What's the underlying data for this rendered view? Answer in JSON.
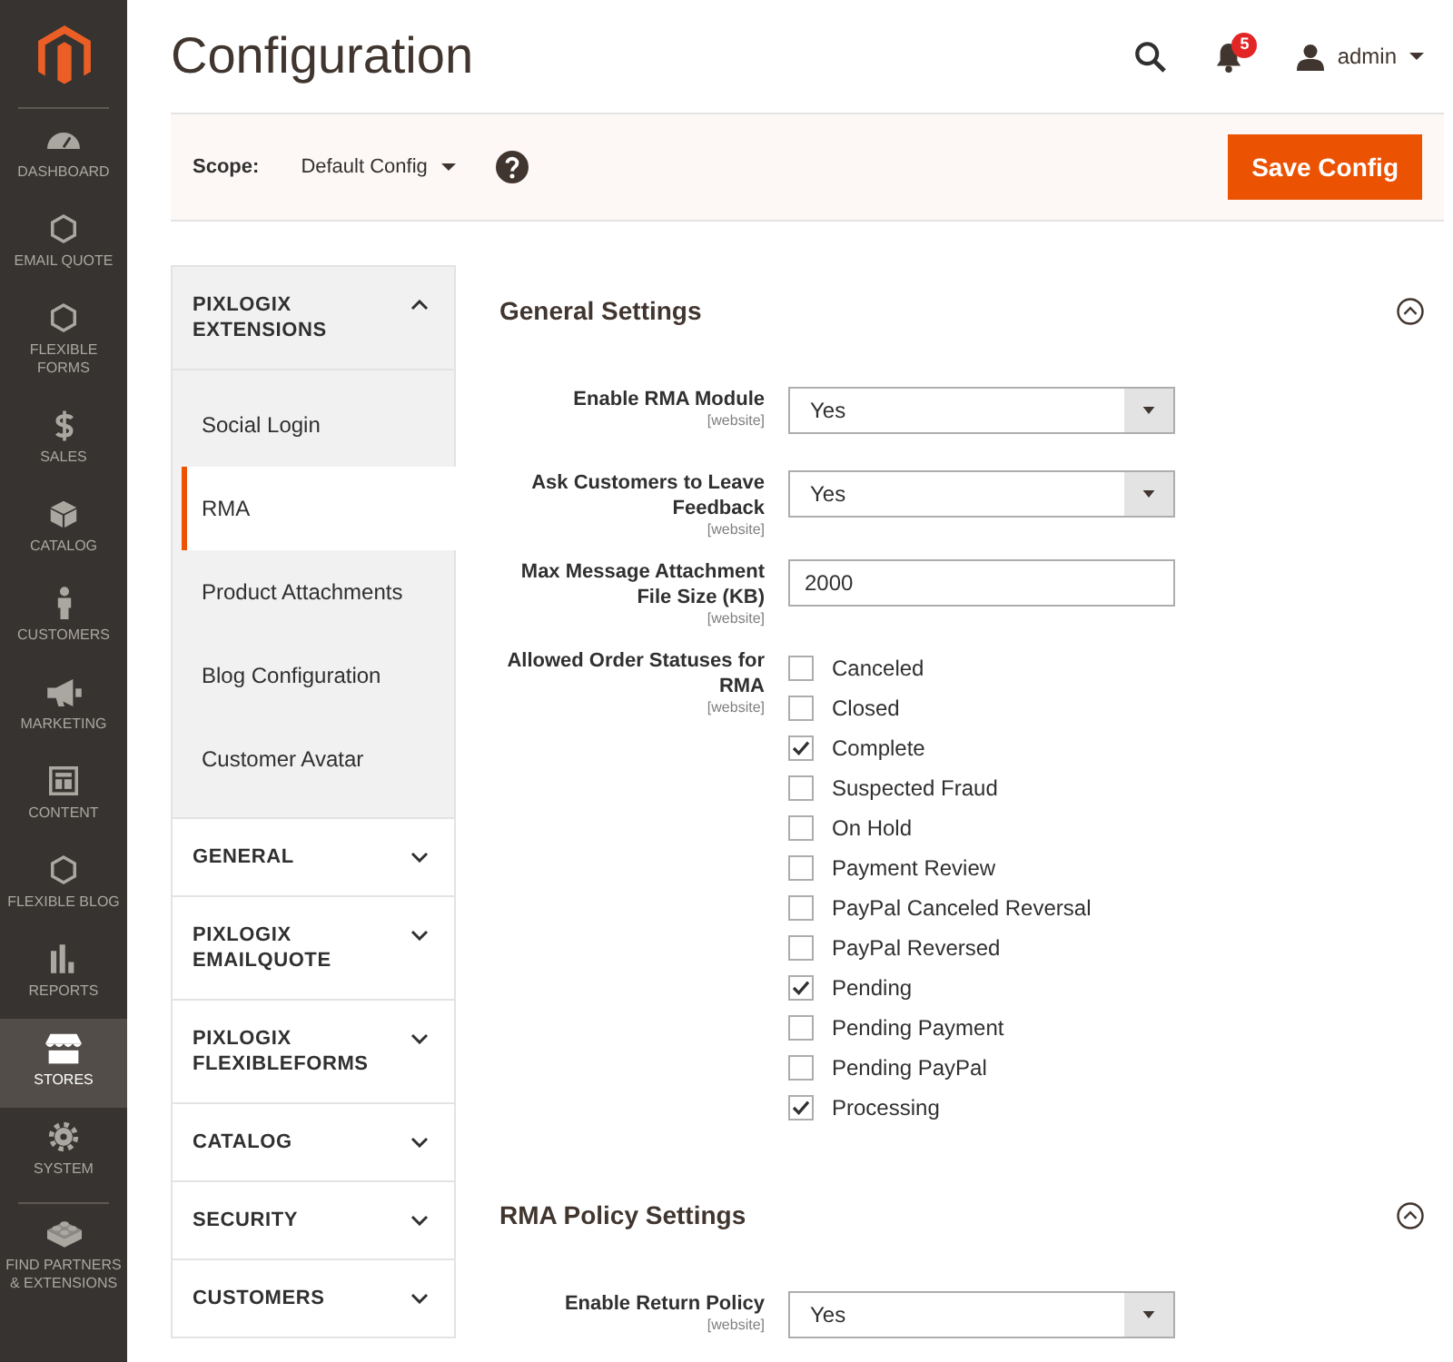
{
  "sidebar": {
    "items": [
      {
        "label": "DASHBOARD",
        "selected": false
      },
      {
        "label": "EMAIL QUOTE",
        "selected": false
      },
      {
        "label": "FLEXIBLE FORMS",
        "selected": false
      },
      {
        "label": "SALES",
        "selected": false
      },
      {
        "label": "CATALOG",
        "selected": false
      },
      {
        "label": "CUSTOMERS",
        "selected": false
      },
      {
        "label": "MARKETING",
        "selected": false
      },
      {
        "label": "CONTENT",
        "selected": false
      },
      {
        "label": "FLEXIBLE BLOG",
        "selected": false
      },
      {
        "label": "REPORTS",
        "selected": false
      },
      {
        "label": "STORES",
        "selected": true
      },
      {
        "label": "SYSTEM",
        "selected": false
      }
    ],
    "partners_link": "FIND PARTNERS & EXTENSIONS"
  },
  "header": {
    "title": "Configuration",
    "notification_count": "5",
    "user": "admin"
  },
  "scope_bar": {
    "label": "Scope:",
    "value": "Default Config",
    "save_button": "Save Config"
  },
  "config_nav": [
    {
      "label": "PIXLOGIX EXTENSIONS",
      "expanded": true,
      "items": [
        {
          "label": "Social Login",
          "selected": false
        },
        {
          "label": "RMA",
          "selected": true
        },
        {
          "label": "Product Attachments",
          "selected": false
        },
        {
          "label": "Blog Configuration",
          "selected": false
        },
        {
          "label": "Customer Avatar",
          "selected": false
        }
      ]
    },
    {
      "label": "GENERAL",
      "expanded": false
    },
    {
      "label": "PIXLOGIX EMAILQUOTE",
      "expanded": false
    },
    {
      "label": "PIXLOGIX FLEXIBLEFORMS",
      "expanded": false
    },
    {
      "label": "CATALOG",
      "expanded": false
    },
    {
      "label": "SECURITY",
      "expanded": false
    },
    {
      "label": "CUSTOMERS",
      "expanded": false
    }
  ],
  "sections": [
    {
      "title": "General Settings",
      "expanded": true,
      "fields": [
        {
          "kind": "select",
          "label": "Enable RMA Module",
          "scope": "[website]",
          "value": "Yes"
        },
        {
          "kind": "select",
          "label": "Ask Customers to Leave Feedback",
          "scope": "[website]",
          "value": "Yes"
        },
        {
          "kind": "text",
          "label": "Max Message Attachment File Size (KB)",
          "scope": "[website]",
          "value": "2000"
        },
        {
          "kind": "checklist",
          "label": "Allowed Order Statuses for RMA",
          "scope": "[website]",
          "options": [
            {
              "label": "Canceled",
              "checked": false
            },
            {
              "label": "Closed",
              "checked": false
            },
            {
              "label": "Complete",
              "checked": true
            },
            {
              "label": "Suspected Fraud",
              "checked": false
            },
            {
              "label": "On Hold",
              "checked": false
            },
            {
              "label": "Payment Review",
              "checked": false
            },
            {
              "label": "PayPal Canceled Reversal",
              "checked": false
            },
            {
              "label": "PayPal Reversed",
              "checked": false
            },
            {
              "label": "Pending",
              "checked": true
            },
            {
              "label": "Pending Payment",
              "checked": false
            },
            {
              "label": "Pending PayPal",
              "checked": false
            },
            {
              "label": "Processing",
              "checked": true
            }
          ]
        }
      ]
    },
    {
      "title": "RMA Policy Settings",
      "expanded": true,
      "fields": [
        {
          "kind": "select",
          "label": "Enable Return Policy",
          "scope": "[website]",
          "value": "Yes"
        }
      ]
    }
  ]
}
